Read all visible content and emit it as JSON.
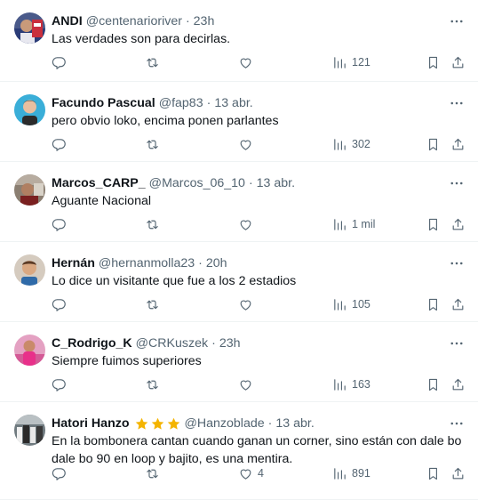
{
  "colors": {
    "text": "#0f1419",
    "muted": "#536471",
    "divider": "#eff3f4",
    "star": "#f4b400"
  },
  "icons": {
    "more": "more-horizontal-icon",
    "reply": "reply-icon",
    "retweet": "retweet-icon",
    "like": "like-icon",
    "views": "views-icon",
    "bookmark": "bookmark-icon",
    "share": "share-icon"
  },
  "tweets": [
    {
      "name": "ANDI",
      "handle": "@centenarioriver",
      "time": "23h",
      "text": "Las verdades son para decirlas.",
      "likes": "",
      "views": "121"
    },
    {
      "name": "Facundo Pascual",
      "handle": "@fap83",
      "time": "13 abr.",
      "text": "pero obvio loko, encima ponen parlantes",
      "likes": "",
      "views": "302"
    },
    {
      "name": "Marcos_CARP_",
      "handle": "@Marcos_06_10",
      "time": "13 abr.",
      "text": "Aguante Nacional",
      "likes": "",
      "views": "1 mil"
    },
    {
      "name": "Hernán",
      "handle": "@hernanmolla23",
      "time": "20h",
      "text": "Lo dice un visitante que fue a los 2 estadios",
      "likes": "",
      "views": "105"
    },
    {
      "name": "C_Rodrigo_K",
      "handle": "@CRKuszek",
      "time": "23h",
      "text": "Siempre fuimos superiores",
      "likes": "",
      "views": "163"
    },
    {
      "name": "Hatori Hanzo",
      "handle": "@Hanzoblade",
      "time": "13 abr.",
      "text": "En la bombonera cantan cuando ganan un corner, sino están con dale bo dale bo 90 en loop y bajito, es una mentira.",
      "likes": "4",
      "views": "891",
      "stars": 3
    }
  ]
}
